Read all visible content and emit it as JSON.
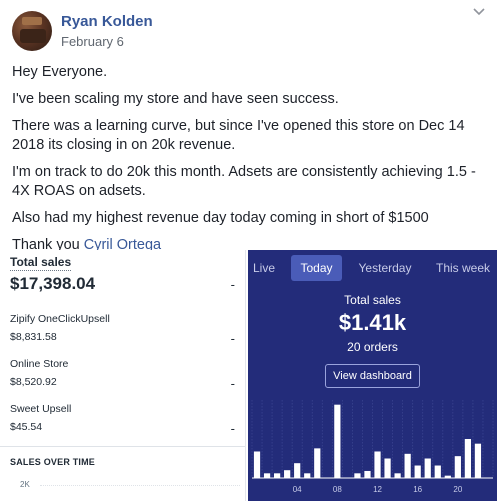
{
  "post": {
    "author": "Ryan Kolden",
    "date": "February 6",
    "paragraphs": [
      "Hey Everyone.",
      "I've been scaling my store and have seen success.",
      "There was a learning curve, but since I've opened this store on Dec 14 2018 its closing in on 20k revenue.",
      "I'm on track to do 20k this month. Adsets are consistently achieving 1.5 - 4X ROAS on adsets.",
      "Also had my highest revenue day today coming in short of $1500"
    ],
    "thanks": "Thank you",
    "mention": "Cyril Ortega",
    "more_icon": "chevron-down-icon"
  },
  "sales_panel": {
    "title": "Total sales",
    "total": "$17,398.04",
    "dash": "-",
    "rows": [
      {
        "label": "Zipify OneClickUpsell",
        "value": "$8,831.58"
      },
      {
        "label": "Online Store",
        "value": "$8,520.92"
      },
      {
        "label": "Sweet Upsell",
        "value": "$45.54"
      }
    ],
    "section_title": "SALES OVER TIME",
    "y_tick": "2K"
  },
  "live_panel": {
    "tabs": [
      "Live",
      "Today",
      "Yesterday",
      "This week"
    ],
    "active_tab": "Today",
    "stat_label": "Total sales",
    "stat_value": "$1.41k",
    "orders": "20 orders",
    "button": "View dashboard",
    "colors": {
      "background": "#232c7a",
      "active_tab": "#4a5cb8",
      "bars": "#ffffff"
    }
  },
  "chart_data": {
    "type": "bar",
    "x_tick_labels": [
      "04",
      "08",
      "12",
      "16",
      "20"
    ],
    "hours": [
      0,
      1,
      2,
      3,
      4,
      5,
      6,
      7,
      8,
      9,
      10,
      11,
      12,
      13,
      14,
      15,
      16,
      17,
      18,
      19,
      20,
      21,
      22,
      23
    ],
    "values": [
      0.34,
      0.06,
      0.06,
      0.1,
      0.19,
      0.06,
      0.38,
      0.0,
      0.94,
      0.0,
      0.06,
      0.09,
      0.34,
      0.25,
      0.06,
      0.31,
      0.16,
      0.25,
      0.16,
      0.03,
      0.28,
      0.5,
      0.44,
      0.0
    ],
    "ylim": [
      0,
      1
    ],
    "grid": true
  }
}
